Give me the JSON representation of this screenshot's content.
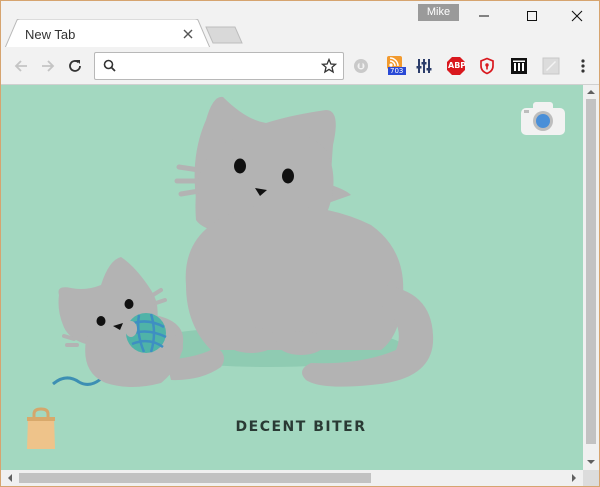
{
  "window": {
    "profile_name": "Mike",
    "controls": [
      "minimize",
      "maximize",
      "close"
    ]
  },
  "tabs": [
    {
      "title": "New Tab",
      "active": true
    }
  ],
  "toolbar": {
    "omnibox": {
      "value": "",
      "placeholder": ""
    },
    "extensions": [
      {
        "icon": "circle-o-icon"
      },
      {
        "icon": "rss-icon",
        "badge": "703"
      },
      {
        "icon": "equalizer-icon"
      },
      {
        "icon": "abp-icon",
        "label": "ABP"
      },
      {
        "icon": "shield-icon"
      },
      {
        "icon": "library-icon"
      },
      {
        "icon": "square-icon"
      }
    ]
  },
  "page": {
    "brand_text": "DECENT BITER",
    "background": "#a3d8c0"
  },
  "colors": {
    "accent_border": "#d6a46f",
    "cat": "#b3b3b3",
    "abp_red": "#d9181e",
    "badge_blue": "#2a4ad6"
  }
}
